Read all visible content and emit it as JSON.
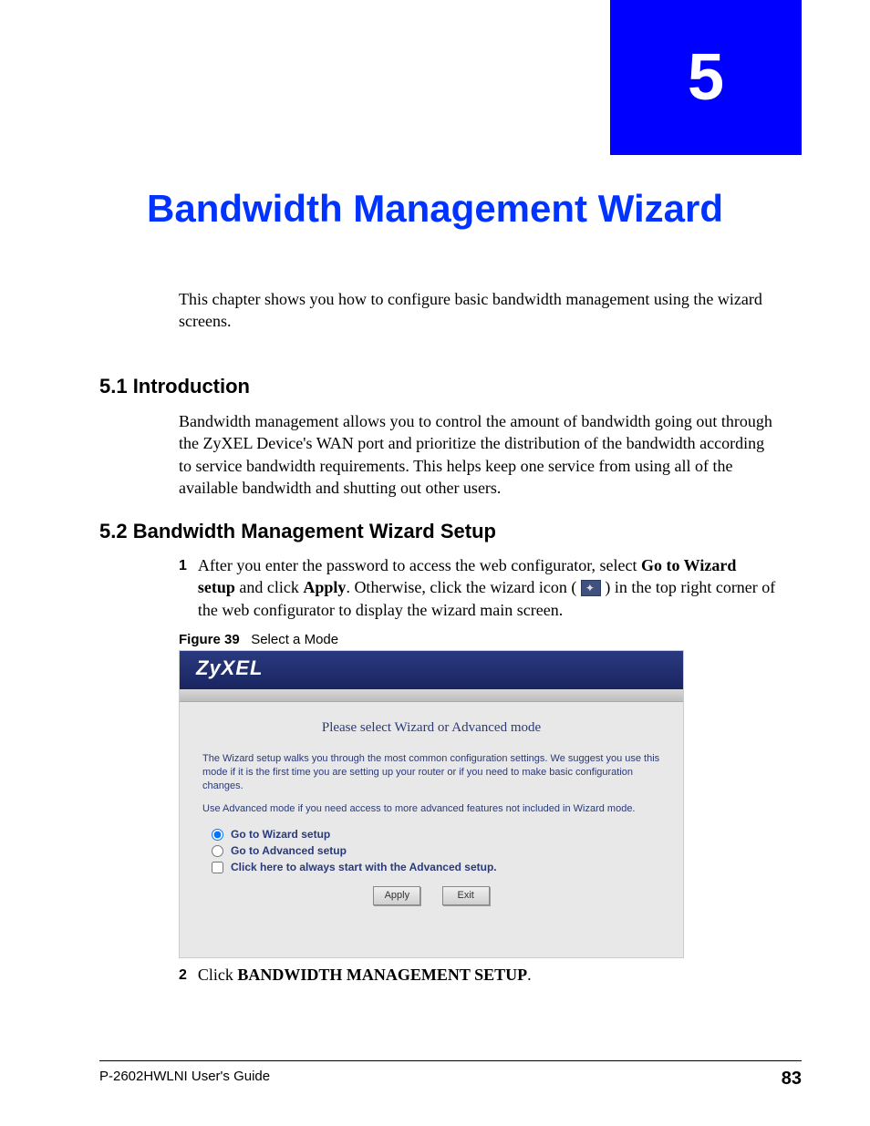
{
  "chapter_number": "5",
  "page_title": "Bandwidth Management Wizard",
  "intro_paragraph": "This chapter shows you how to configure basic bandwidth management using the wizard screens.",
  "section1": {
    "heading": "5.1  Introduction",
    "body": "Bandwidth management allows you to control the amount of bandwidth going out through the ZyXEL Device's WAN port and prioritize the distribution of the bandwidth according to service bandwidth requirements. This helps keep one service from using all of the available bandwidth and shutting out other users."
  },
  "section2": {
    "heading": "5.2  Bandwidth Management Wizard Setup",
    "step1": {
      "num": "1",
      "pre": "After you enter the password to access the web configurator, select ",
      "bold1": "Go to Wizard setup",
      "mid1": " and click ",
      "bold2": "Apply",
      "mid2": ". Otherwise, click the wizard icon ( ",
      "mid3": " ) in the top right corner of the web configurator to display the wizard main screen."
    },
    "step2": {
      "num": "2",
      "pre": "Click ",
      "bold": "BANDWIDTH MANAGEMENT SETUP",
      "post": "."
    }
  },
  "figure": {
    "label": "Figure 39",
    "caption": "Select a Mode",
    "brand": "ZyXEL",
    "prompt": "Please select Wizard or Advanced mode",
    "desc1": "The Wizard setup walks you through the most common configuration settings. We suggest you use this mode if it is the first time you are setting up your router or if you need to make basic configuration changes.",
    "desc2": "Use Advanced mode if you need access to more advanced features not included in Wizard mode.",
    "opt_wizard": "Go to Wizard setup",
    "opt_advanced": "Go to Advanced setup",
    "opt_always": "Click here to always start with the Advanced setup.",
    "btn_apply": "Apply",
    "btn_exit": "Exit"
  },
  "footer": {
    "guide": "P-2602HWLNI User's Guide",
    "page": "83"
  }
}
